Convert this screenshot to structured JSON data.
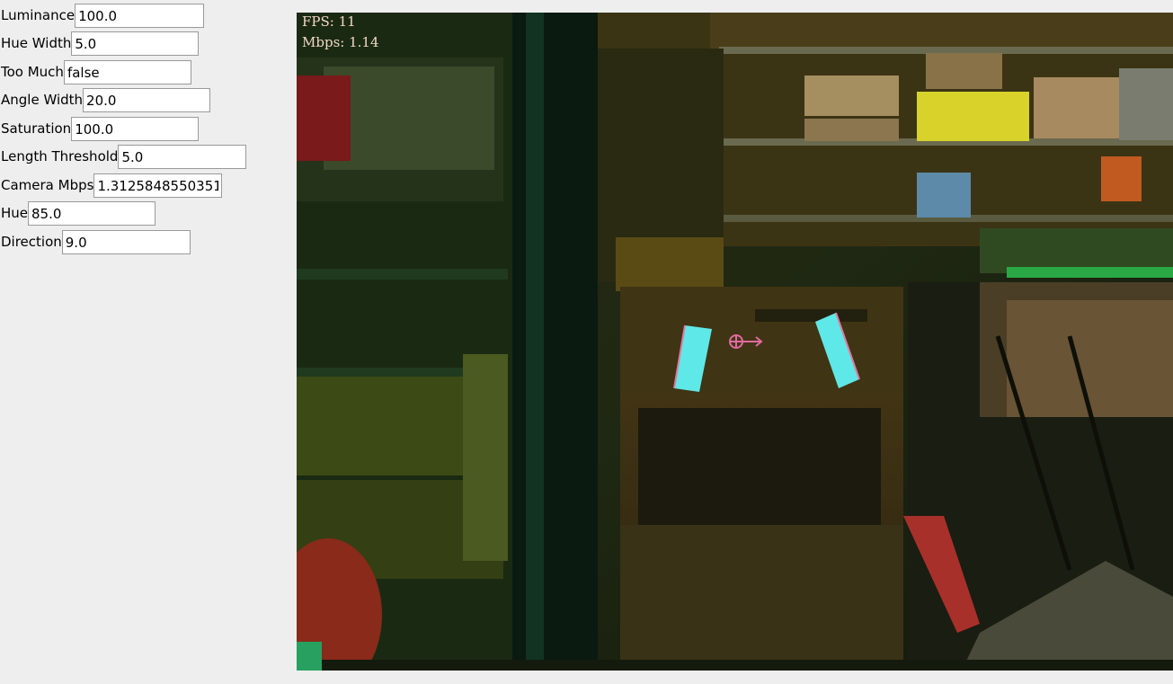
{
  "controls": [
    {
      "label": "Luminance",
      "value": "100.0"
    },
    {
      "label": "Hue Width",
      "value": "5.0"
    },
    {
      "label": "Too Much",
      "value": "false"
    },
    {
      "label": "Angle Width",
      "value": "20.0"
    },
    {
      "label": "Saturation",
      "value": "100.0"
    },
    {
      "label": "Length Threshold",
      "value": "5.0"
    },
    {
      "label": "Camera Mbps",
      "value": "1.3125848550351"
    },
    {
      "label": "Hue",
      "value": "85.0"
    },
    {
      "label": "Direction",
      "value": "9.0"
    }
  ],
  "camera": {
    "fps_text": "FPS: 11",
    "mbps_text": "Mbps: 1.14"
  },
  "colors": {
    "target_fill": "#5fe8e8",
    "target_edge": "#e07aa0",
    "crosshair": "#e06aa0",
    "overlay_text": "#f3d7c4"
  }
}
